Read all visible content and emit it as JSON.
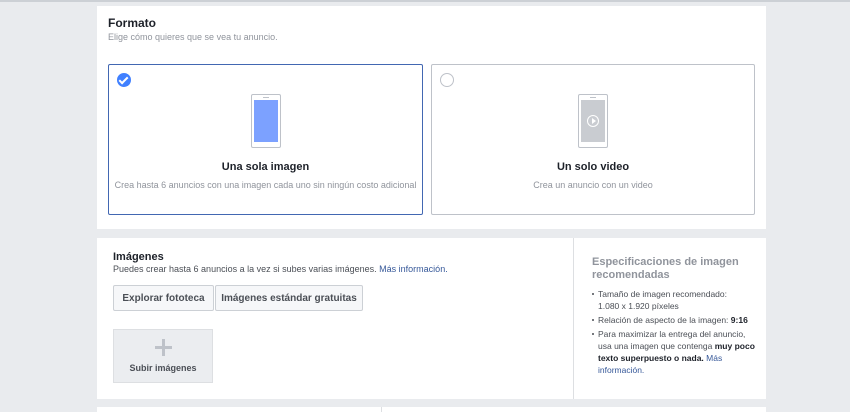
{
  "format": {
    "title": "Formato",
    "subtitle": "Elige cómo quieres que se vea tu anuncio.",
    "options": [
      {
        "label": "Una sola imagen",
        "desc": "Crea hasta 6 anuncios con una imagen cada uno sin ningún costo adicional",
        "selected": true,
        "icon": "phone-image-icon"
      },
      {
        "label": "Un solo video",
        "desc": "Crea un anuncio con un video",
        "selected": false,
        "icon": "phone-video-icon"
      }
    ]
  },
  "images": {
    "title": "Imágenes",
    "subtitle": "Puedes crear hasta 6 anuncios a la vez si subes varias imágenes.",
    "more_info": "Más información.",
    "buttons": {
      "explore": "Explorar fototeca",
      "stock": "Imágenes estándar gratuitas"
    },
    "upload_label": "Subir imágenes"
  },
  "specs": {
    "title": "Especificaciones de imagen recomendadas",
    "size_label": "Tamaño de imagen recomendado:",
    "size_value": "1.080 x 1.920 píxeles",
    "ratio_label": "Relación de aspecto de la imagen:",
    "ratio_value": "9:16",
    "text_a": "Para maximizar la entrega del anuncio, usa una imagen que contenga",
    "text_bold": "muy poco texto superpuesto o nada.",
    "text_link": "Más información."
  }
}
